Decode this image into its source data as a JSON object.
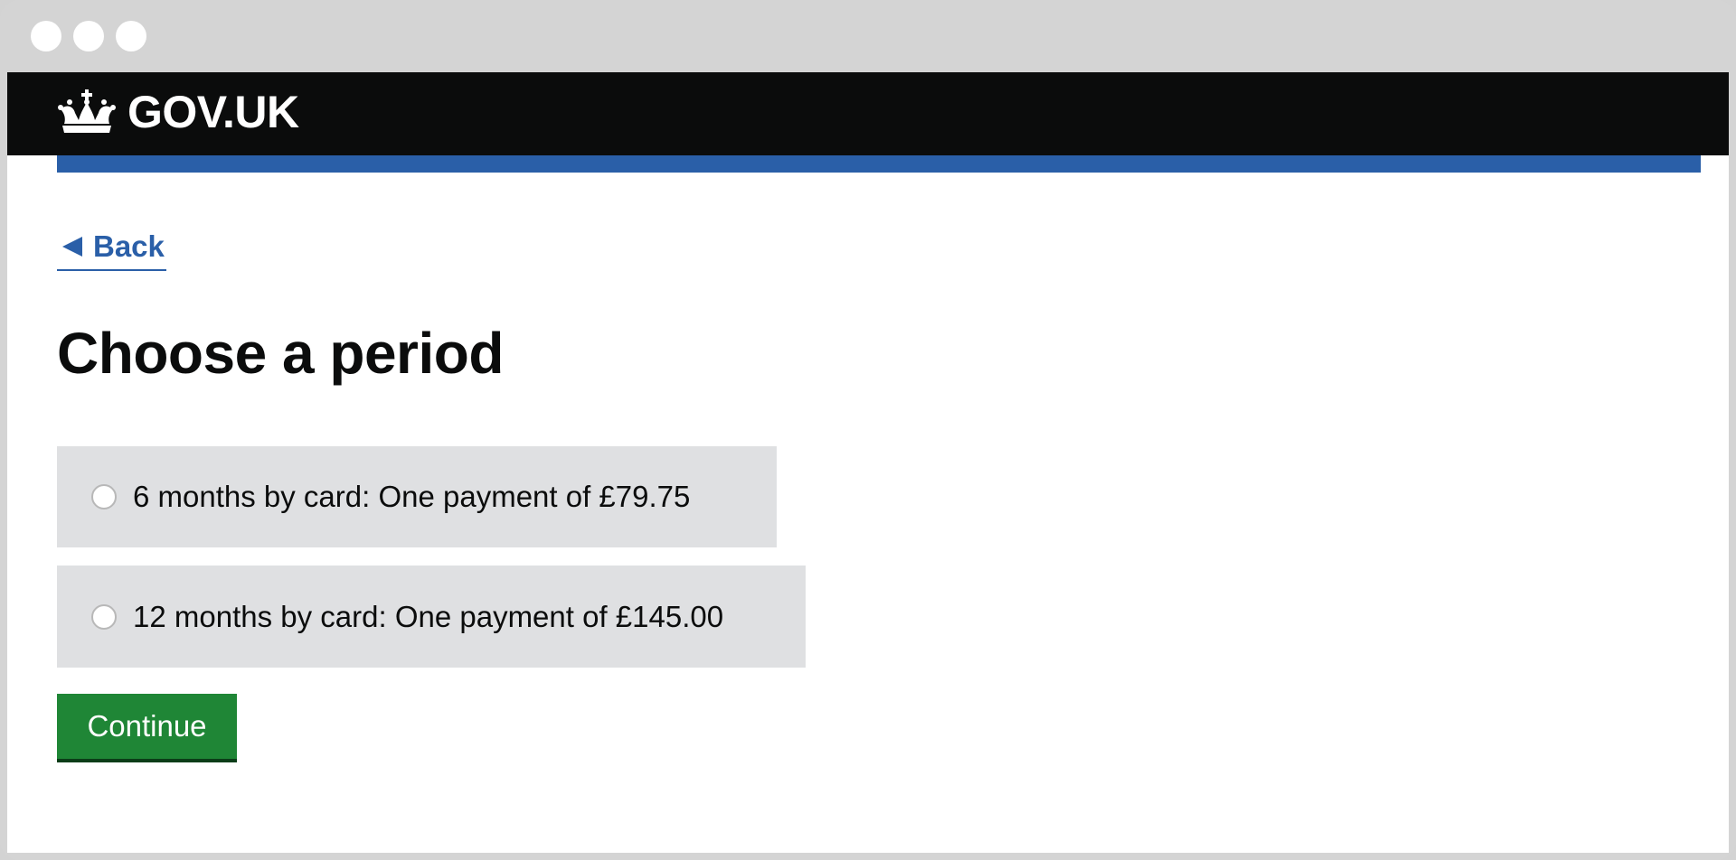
{
  "window": {
    "controls": [
      "close",
      "minimize",
      "maximize"
    ]
  },
  "header": {
    "logo_icon": "crown-icon",
    "logo_text": "GOV.UK"
  },
  "back_link": {
    "label": "Back",
    "icon": "left-triangle-icon"
  },
  "page_title": "Choose a period",
  "options": [
    {
      "label": "6 months by card: One payment of £79.75",
      "selected": false
    },
    {
      "label": "12 months by card: One payment of £145.00",
      "selected": false
    }
  ],
  "continue_label": "Continue",
  "colors": {
    "header_bg": "#0b0c0c",
    "accent_blue": "#2a5fa8",
    "option_bg": "#dfe0e2",
    "button_green": "#1f8636"
  }
}
